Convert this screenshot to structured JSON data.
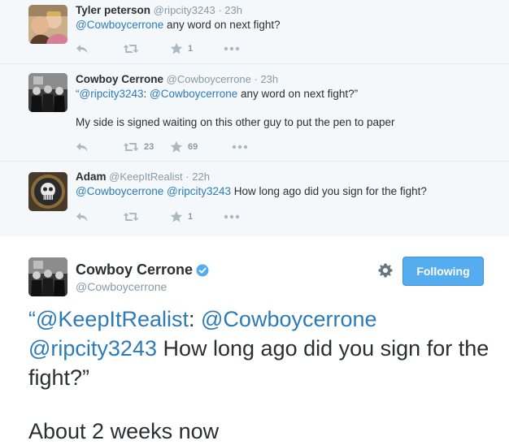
{
  "conversation": [
    {
      "fullname": "Tyler peterson",
      "username": "@ripcity3243",
      "time": "23h",
      "mention": "@Cowboycerrone",
      "text": " any word on next fight?",
      "retweets": "",
      "favorites": "1"
    },
    {
      "fullname": "Cowboy Cerrone",
      "username": "@Cowboycerrone",
      "time": "23h",
      "quote_open": "“",
      "mention1": "@ripcity3243",
      "colon": ": ",
      "mention2": "@Cowboycerrone",
      "text": " any word on next fight?”",
      "text2": "My side is signed waiting on this other guy to put the pen to paper",
      "retweets": "23",
      "favorites": "69"
    },
    {
      "fullname": "Adam",
      "username": "@KeepItRealist",
      "time": "22h",
      "mention1": "@Cowboycerrone",
      "mention2": "@ripcity3243",
      "text": " How long ago did you sign for the fight?",
      "retweets": "",
      "favorites": "1"
    }
  ],
  "main_tweet": {
    "fullname": "Cowboy Cerrone",
    "username": "@Cowboycerrone",
    "follow_label": "Following",
    "quote_open": "“",
    "mention1": "@KeepItRealist",
    "colon": ": ",
    "mention2": "@Cowboycerrone",
    "mention3": "@ripcity3243",
    "text": " How long ago did you sign for the fight?”",
    "reply": "About 2 weeks now"
  },
  "sep": " · ",
  "space": " ",
  "colors": {
    "accent": "#55acee",
    "mention": "#2b7bb9",
    "muted": "#8899a6",
    "icon": "#aab8c2",
    "convo_bg": "#f5f8fa"
  },
  "icons": [
    "reply-icon",
    "retweet-icon",
    "favorite-icon",
    "more-icon",
    "verified-icon",
    "gear-icon"
  ]
}
